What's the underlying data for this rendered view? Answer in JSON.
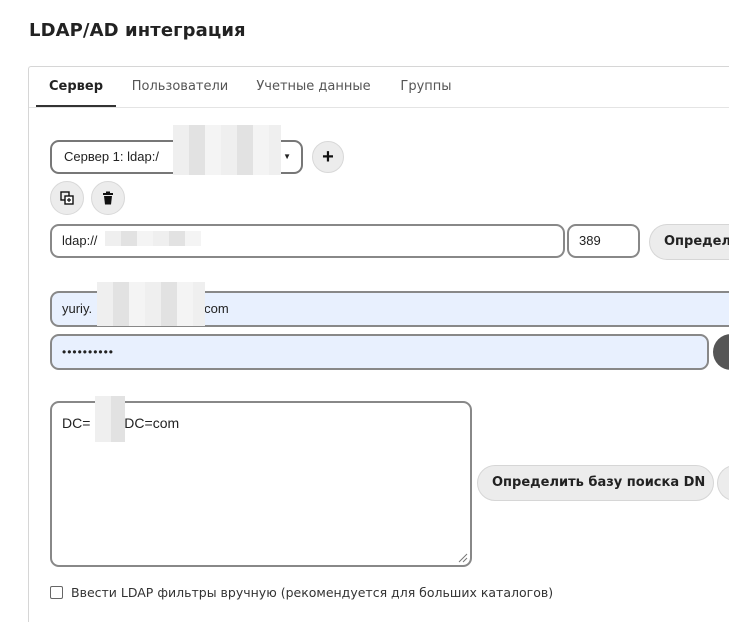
{
  "page": {
    "title": "LDAP/AD интеграция"
  },
  "tabs": [
    {
      "label": "Сервер",
      "active": true
    },
    {
      "label": "Пользователи",
      "active": false
    },
    {
      "label": "Учетные данные",
      "active": false
    },
    {
      "label": "Группы",
      "active": false
    }
  ],
  "server": {
    "selected": "Сервер 1: ldap:/",
    "add_symbol": "+",
    "url": "ldap://",
    "port": "389",
    "detect_label": "Определи"
  },
  "credentials": {
    "username_prefix": "yuriy.",
    "username_suffix": "com",
    "password_mask": "••••••••••"
  },
  "search": {
    "base_dn_prefix": "DC=",
    "base_dn_suffix": ",DC=com",
    "detect_dn_label": "Определить базу поиска DN"
  },
  "filters": {
    "manual_label": "Ввести LDAP фильтры вручную (рекомендуется для больших каталогов)",
    "checked": false
  },
  "colors": {
    "autofill_bg": "#e8f0fe",
    "button_bg": "#ececec",
    "dark_button": "#555555"
  },
  "icons": [
    "plus-icon",
    "copy-icon",
    "trash-icon",
    "caret-down-icon",
    "resize-grip-icon"
  ]
}
